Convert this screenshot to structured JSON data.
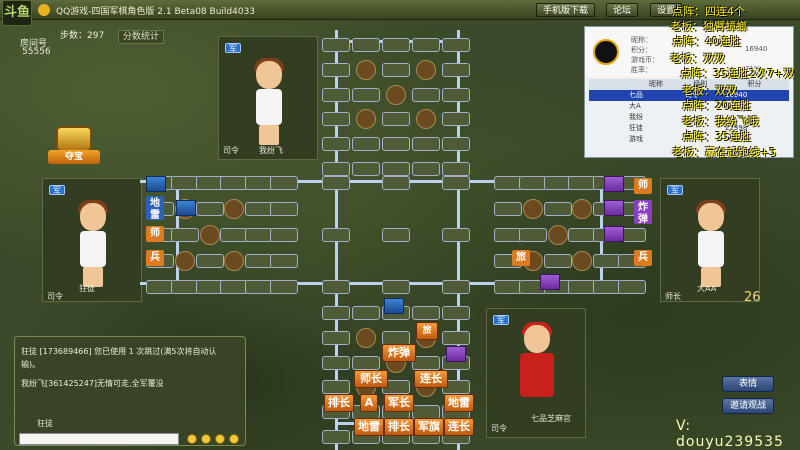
{
  "app": {
    "title": "QQ游戏-四国军棋角色版 2.1 Beta08 Build4033",
    "logo_text": "斗鱼",
    "buttons": [
      "手机版下载",
      "论坛",
      "设置"
    ]
  },
  "room": {
    "label": "房间号",
    "value": "55556",
    "steps_label": "步数：297",
    "stats_button": "分数统计"
  },
  "treasure": {
    "label": "夺宝"
  },
  "players": {
    "top": {
      "badge": "军",
      "rank": "司令",
      "name": "我纷飞"
    },
    "left": {
      "badge": "军",
      "rank": "司令",
      "name": "狂徒"
    },
    "right": {
      "badge": "军",
      "rank": "师长",
      "name": "大AA"
    },
    "bottom": {
      "badge": "军",
      "rank": "司令",
      "name": "七品芝麻官"
    }
  },
  "pieces": {
    "bottom": {
      "row1": [
        "炸弹"
      ],
      "row2": [
        "师长",
        "连长"
      ],
      "row3": [
        "排长",
        "A",
        "军长",
        "地雷"
      ],
      "row4": [
        "地雷",
        "排长",
        "军旗",
        "连长"
      ],
      "extra": "旅"
    },
    "left": [
      "地雷",
      "师",
      "兵"
    ],
    "right": [
      "师",
      "炸弹",
      "兵"
    ],
    "right_inner": "旅"
  },
  "chat": {
    "lines": [
      "狂徒 [173689466] 您已使用 1 次跳过(满5次将自动认输)。",
      "我纷飞[361425247]无情可走,全军覆没"
    ],
    "bottom_name": "狂徒",
    "input_placeholder": ""
  },
  "info_panel": {
    "labels": [
      "昵称：",
      "积分：",
      "游戏币：",
      "胜率："
    ],
    "values": [
      "",
      "16940",
      "",
      "71%"
    ],
    "table_headers": [
      "昵称",
      "级别",
      "积分"
    ],
    "rows": [
      {
        "name": "七品",
        "level": "司令",
        "score": "16940",
        "selected": true
      },
      {
        "name": "大A",
        "level": "",
        "score": "",
        "selected": false
      },
      {
        "name": "我纷",
        "level": "",
        "score": "",
        "selected": false
      },
      {
        "name": "狂徒",
        "level": "",
        "score": "22398",
        "selected": false
      },
      {
        "name": "游戏",
        "level": "",
        "score": "",
        "selected": false
      }
    ]
  },
  "overlay": [
    "点阵：四连4个",
    "老板：独臂蟑螂",
    "点阵：40连胜",
    "老板：双双",
    "点阵：35连胜2次7+双",
    "老板：双双",
    "点阵：20连胜",
    "老板：我纷飞哦",
    "点阵：35连胜",
    "老板：赢在起跑线+5"
  ],
  "right_buttons": {
    "emote": "表情",
    "invite": "邀请观战"
  },
  "right_score": "26",
  "watermark": "V: douyu239535",
  "colors": {
    "accent_orange": "#e07a1f",
    "blue_piece": "#2c63b8",
    "purple_piece": "#8a3fbf"
  }
}
